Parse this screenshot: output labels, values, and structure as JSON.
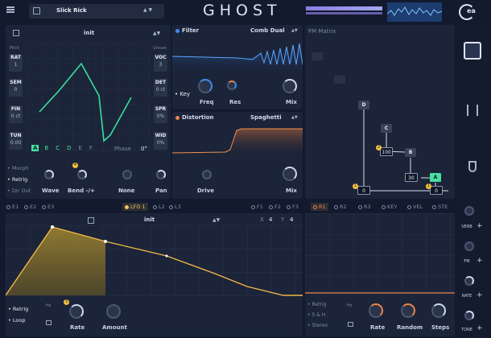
{
  "header": {
    "preset": "Slick Rick",
    "logo": "GHOST",
    "brand": "ea",
    "icons": [
      "menu-icon",
      "save-icon",
      "arrows-icon"
    ]
  },
  "osc": {
    "patch": "init",
    "pitch": "Pitch",
    "unison": "Unison",
    "left": [
      {
        "k": "RAT",
        "v": "1"
      },
      {
        "k": "SEM",
        "v": "0"
      },
      {
        "k": "FIN",
        "v": "0 ct"
      },
      {
        "k": "TUN",
        "v": "0.00"
      }
    ],
    "right": [
      {
        "k": "VOC",
        "v": "3"
      },
      {
        "k": "DET",
        "v": "0 ct"
      },
      {
        "k": "SPR",
        "v": "0%"
      },
      {
        "k": "WID",
        "v": "0%"
      }
    ],
    "letters": [
      "A",
      "B",
      "C",
      "D",
      "E",
      "F"
    ],
    "phase": "Phase",
    "phase_val": "0°"
  },
  "filter": {
    "label": "Filter",
    "type": "Comb Dual",
    "key": "Key",
    "knobs": [
      "Freq",
      "Res",
      "Mix"
    ]
  },
  "distortion": {
    "label": "Distortion",
    "type": "Spaghetti",
    "knobs": [
      "Drive",
      "Mix"
    ]
  },
  "fm": {
    "label": "FM Matrix",
    "nodes": [
      "D",
      "C",
      "B",
      "A"
    ],
    "values": [
      "100",
      "30",
      "0",
      "0"
    ],
    "badges": [
      "2",
      "1",
      "1"
    ]
  },
  "mods": {
    "items": [
      "Morph",
      "Retrig",
      "Dir Out"
    ],
    "labels": [
      "Wave",
      "Bend -/+",
      "None",
      "Pan"
    ],
    "badge": "4"
  },
  "env_tabs": [
    "E1",
    "E2",
    "E3"
  ],
  "lfo_tabs": [
    "LFO 1",
    "L2",
    "L3"
  ],
  "f_tabs": [
    "F1",
    "F2",
    "F3"
  ],
  "r_tabs": [
    "R1",
    "R2",
    "R3",
    "KEY",
    "VEL",
    "STE"
  ],
  "lfo": {
    "patch": "init",
    "x": "X",
    "xv": "4",
    "y": "Y",
    "yv": "4",
    "opts": [
      "Retrig",
      "Loop"
    ],
    "hz": "Hz",
    "knobs": [
      "Rate",
      "Amount"
    ],
    "badge": "3"
  },
  "rand": {
    "opts": [
      "Retrig",
      "S & H",
      "Stereo"
    ],
    "hz": "Hz",
    "knobs": [
      "Rate",
      "Random",
      "Steps"
    ]
  },
  "sidebar": {
    "items": [
      "VERB",
      "FM",
      "RATE",
      "TONE"
    ]
  }
}
